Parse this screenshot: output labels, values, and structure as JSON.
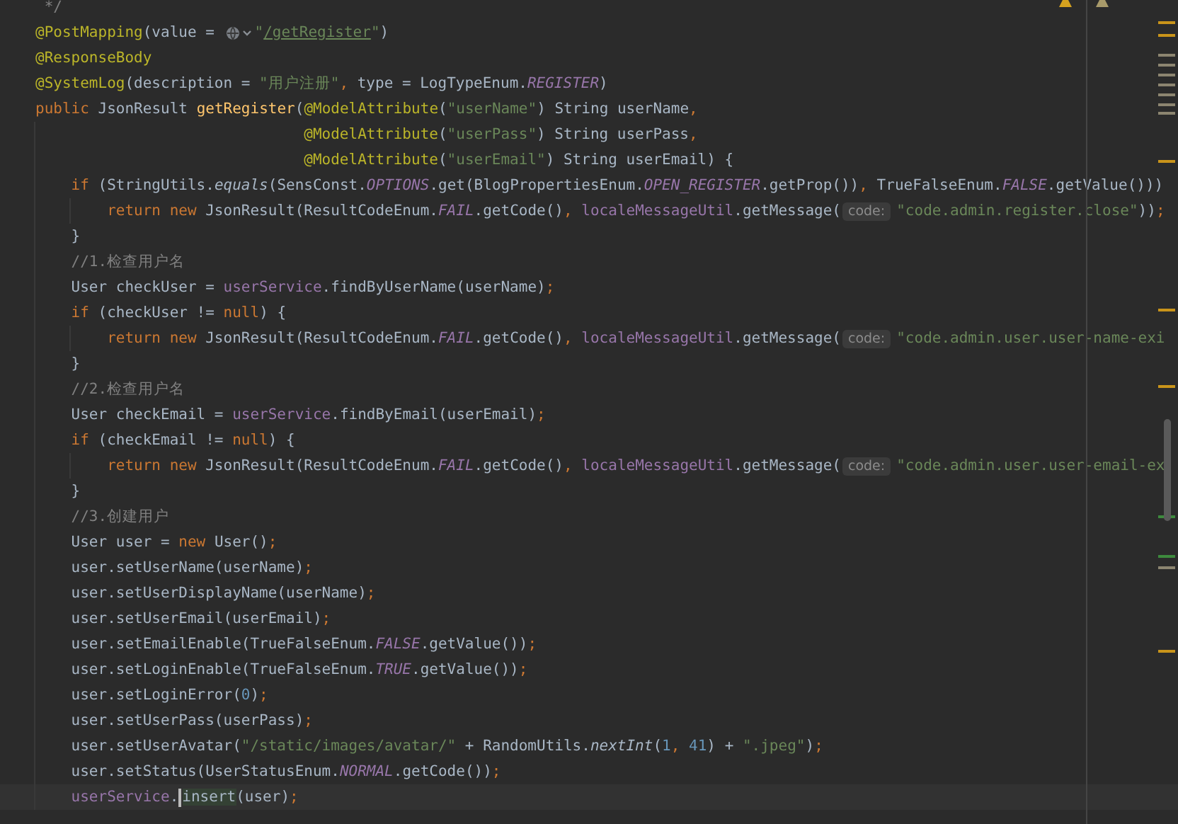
{
  "editor": {
    "lines": [
      {
        "current": false,
        "tokens": [
          {
            "kind": "comment",
            "text": " */"
          }
        ]
      },
      {
        "current": false,
        "tokens": [
          {
            "kind": "annotation",
            "text": "@PostMapping"
          },
          {
            "kind": "plain",
            "text": "(value = "
          },
          {
            "kind": "globe-icon"
          },
          {
            "kind": "string",
            "text": "\""
          },
          {
            "kind": "url",
            "text": "/getRegister"
          },
          {
            "kind": "string",
            "text": "\""
          },
          {
            "kind": "plain",
            "text": ")"
          }
        ]
      },
      {
        "current": false,
        "tokens": [
          {
            "kind": "annotation",
            "text": "@ResponseBody"
          }
        ]
      },
      {
        "current": false,
        "tokens": [
          {
            "kind": "annotation",
            "text": "@SystemLog"
          },
          {
            "kind": "plain",
            "text": "(description = "
          },
          {
            "kind": "string",
            "text": "\"用户注册\""
          },
          {
            "kind": "punct",
            "text": ", "
          },
          {
            "kind": "plain",
            "text": "type = LogTypeEnum."
          },
          {
            "kind": "constant",
            "text": "REGISTER"
          },
          {
            "kind": "plain",
            "text": ")"
          }
        ]
      },
      {
        "current": false,
        "tokens": [
          {
            "kind": "keyword",
            "text": "public "
          },
          {
            "kind": "plain",
            "text": "JsonResult "
          },
          {
            "kind": "method",
            "text": "getRegister"
          },
          {
            "kind": "plain",
            "text": "("
          },
          {
            "kind": "annotation",
            "text": "@ModelAttribute"
          },
          {
            "kind": "plain",
            "text": "("
          },
          {
            "kind": "string",
            "text": "\"userName\""
          },
          {
            "kind": "plain",
            "text": ") String userName"
          },
          {
            "kind": "punct",
            "text": ","
          }
        ]
      },
      {
        "current": false,
        "tokens": [
          {
            "kind": "annotation",
            "text": "                              @ModelAttribute"
          },
          {
            "kind": "plain",
            "text": "("
          },
          {
            "kind": "string",
            "text": "\"userPass\""
          },
          {
            "kind": "plain",
            "text": ") String userPass"
          },
          {
            "kind": "punct",
            "text": ","
          }
        ]
      },
      {
        "current": false,
        "tokens": [
          {
            "kind": "annotation",
            "text": "                              @ModelAttribute"
          },
          {
            "kind": "plain",
            "text": "("
          },
          {
            "kind": "string",
            "text": "\"userEmail\""
          },
          {
            "kind": "plain",
            "text": ") String userEmail) {"
          }
        ]
      },
      {
        "current": false,
        "tokens": [
          {
            "kind": "keyword",
            "text": "    if "
          },
          {
            "kind": "plain",
            "text": "(StringUtils."
          },
          {
            "kind": "static",
            "text": "equals"
          },
          {
            "kind": "plain",
            "text": "(SensConst."
          },
          {
            "kind": "constant",
            "text": "OPTIONS"
          },
          {
            "kind": "plain",
            "text": ".get(BlogPropertiesEnum."
          },
          {
            "kind": "constant",
            "text": "OPEN_REGISTER"
          },
          {
            "kind": "plain",
            "text": ".getProp())"
          },
          {
            "kind": "punct",
            "text": ", "
          },
          {
            "kind": "plain",
            "text": "TrueFalseEnum."
          },
          {
            "kind": "constant",
            "text": "FALSE"
          },
          {
            "kind": "plain",
            "text": ".getValue()))"
          }
        ]
      },
      {
        "current": false,
        "tokens": [
          {
            "kind": "keyword",
            "text": "        return new "
          },
          {
            "kind": "plain",
            "text": "JsonResult(ResultCodeEnum."
          },
          {
            "kind": "constant",
            "text": "FAIL"
          },
          {
            "kind": "plain",
            "text": ".getCode()"
          },
          {
            "kind": "punct",
            "text": ", "
          },
          {
            "kind": "field",
            "text": "localeMessageUtil"
          },
          {
            "kind": "plain",
            "text": ".getMessage("
          },
          {
            "kind": "hint",
            "text": "code:"
          },
          {
            "kind": "string",
            "text": "\"code.admin.register.close\""
          },
          {
            "kind": "plain",
            "text": "))"
          },
          {
            "kind": "punct",
            "text": ";"
          }
        ]
      },
      {
        "current": false,
        "tokens": [
          {
            "kind": "plain",
            "text": "    }"
          }
        ]
      },
      {
        "current": false,
        "tokens": [
          {
            "kind": "comment",
            "text": "    //1.检查用户名"
          }
        ]
      },
      {
        "current": false,
        "tokens": [
          {
            "kind": "plain",
            "text": "    User checkUser = "
          },
          {
            "kind": "field",
            "text": "userService"
          },
          {
            "kind": "plain",
            "text": ".findByUserName(userName)"
          },
          {
            "kind": "punct",
            "text": ";"
          }
        ]
      },
      {
        "current": false,
        "tokens": [
          {
            "kind": "keyword",
            "text": "    if "
          },
          {
            "kind": "plain",
            "text": "(checkUser != "
          },
          {
            "kind": "keyword",
            "text": "null"
          },
          {
            "kind": "plain",
            "text": ") {"
          }
        ]
      },
      {
        "current": false,
        "tokens": [
          {
            "kind": "keyword",
            "text": "        return new "
          },
          {
            "kind": "plain",
            "text": "JsonResult(ResultCodeEnum."
          },
          {
            "kind": "constant",
            "text": "FAIL"
          },
          {
            "kind": "plain",
            "text": ".getCode()"
          },
          {
            "kind": "punct",
            "text": ", "
          },
          {
            "kind": "field",
            "text": "localeMessageUtil"
          },
          {
            "kind": "plain",
            "text": ".getMessage("
          },
          {
            "kind": "hint",
            "text": "code:"
          },
          {
            "kind": "string",
            "text": "\"code.admin.user.user-name-exi"
          }
        ]
      },
      {
        "current": false,
        "tokens": [
          {
            "kind": "plain",
            "text": "    }"
          }
        ]
      },
      {
        "current": false,
        "tokens": [
          {
            "kind": "comment",
            "text": "    //2.检查用户名"
          }
        ]
      },
      {
        "current": false,
        "tokens": [
          {
            "kind": "plain",
            "text": "    User checkEmail = "
          },
          {
            "kind": "field",
            "text": "userService"
          },
          {
            "kind": "plain",
            "text": ".findByEmail(userEmail)"
          },
          {
            "kind": "punct",
            "text": ";"
          }
        ]
      },
      {
        "current": false,
        "tokens": [
          {
            "kind": "keyword",
            "text": "    if "
          },
          {
            "kind": "plain",
            "text": "(checkEmail != "
          },
          {
            "kind": "keyword",
            "text": "null"
          },
          {
            "kind": "plain",
            "text": ") {"
          }
        ]
      },
      {
        "current": false,
        "tokens": [
          {
            "kind": "keyword",
            "text": "        return new "
          },
          {
            "kind": "plain",
            "text": "JsonResult(ResultCodeEnum."
          },
          {
            "kind": "constant",
            "text": "FAIL"
          },
          {
            "kind": "plain",
            "text": ".getCode()"
          },
          {
            "kind": "punct",
            "text": ", "
          },
          {
            "kind": "field",
            "text": "localeMessageUtil"
          },
          {
            "kind": "plain",
            "text": ".getMessage("
          },
          {
            "kind": "hint",
            "text": "code:"
          },
          {
            "kind": "string",
            "text": "\"code.admin.user.user-email-ex"
          }
        ]
      },
      {
        "current": false,
        "tokens": [
          {
            "kind": "plain",
            "text": "    }"
          }
        ]
      },
      {
        "current": false,
        "tokens": [
          {
            "kind": "comment",
            "text": "    //3.创建用户"
          }
        ]
      },
      {
        "current": false,
        "tokens": [
          {
            "kind": "plain",
            "text": "    User user = "
          },
          {
            "kind": "keyword",
            "text": "new "
          },
          {
            "kind": "plain",
            "text": "User()"
          },
          {
            "kind": "punct",
            "text": ";"
          }
        ]
      },
      {
        "current": false,
        "tokens": [
          {
            "kind": "plain",
            "text": "    user.setUserName(userName)"
          },
          {
            "kind": "punct",
            "text": ";"
          }
        ]
      },
      {
        "current": false,
        "tokens": [
          {
            "kind": "plain",
            "text": "    user.setUserDisplayName(userName)"
          },
          {
            "kind": "punct",
            "text": ";"
          }
        ]
      },
      {
        "current": false,
        "tokens": [
          {
            "kind": "plain",
            "text": "    user.setUserEmail(userEmail)"
          },
          {
            "kind": "punct",
            "text": ";"
          }
        ]
      },
      {
        "current": false,
        "tokens": [
          {
            "kind": "plain",
            "text": "    user.setEmailEnable(TrueFalseEnum."
          },
          {
            "kind": "constant",
            "text": "FALSE"
          },
          {
            "kind": "plain",
            "text": ".getValue())"
          },
          {
            "kind": "punct",
            "text": ";"
          }
        ]
      },
      {
        "current": false,
        "tokens": [
          {
            "kind": "plain",
            "text": "    user.setLoginEnable(TrueFalseEnum."
          },
          {
            "kind": "constant",
            "text": "TRUE"
          },
          {
            "kind": "plain",
            "text": ".getValue())"
          },
          {
            "kind": "punct",
            "text": ";"
          }
        ]
      },
      {
        "current": false,
        "tokens": [
          {
            "kind": "plain",
            "text": "    user.setLoginError("
          },
          {
            "kind": "number",
            "text": "0"
          },
          {
            "kind": "plain",
            "text": ")"
          },
          {
            "kind": "punct",
            "text": ";"
          }
        ]
      },
      {
        "current": false,
        "tokens": [
          {
            "kind": "plain",
            "text": "    user.setUserPass(userPass)"
          },
          {
            "kind": "punct",
            "text": ";"
          }
        ]
      },
      {
        "current": false,
        "tokens": [
          {
            "kind": "plain",
            "text": "    user.setUserAvatar("
          },
          {
            "kind": "string",
            "text": "\"/static/images/avatar/\""
          },
          {
            "kind": "plain",
            "text": " + RandomUtils."
          },
          {
            "kind": "static",
            "text": "nextInt"
          },
          {
            "kind": "plain",
            "text": "("
          },
          {
            "kind": "number",
            "text": "1"
          },
          {
            "kind": "punct",
            "text": ", "
          },
          {
            "kind": "number",
            "text": "41"
          },
          {
            "kind": "plain",
            "text": ") + "
          },
          {
            "kind": "string",
            "text": "\".jpeg\""
          },
          {
            "kind": "plain",
            "text": ")"
          },
          {
            "kind": "punct",
            "text": ";"
          }
        ]
      },
      {
        "current": false,
        "tokens": [
          {
            "kind": "plain",
            "text": "    user.setStatus(UserStatusEnum."
          },
          {
            "kind": "constant",
            "text": "NORMAL"
          },
          {
            "kind": "plain",
            "text": ".getCode())"
          },
          {
            "kind": "punct",
            "text": ";"
          }
        ]
      },
      {
        "current": true,
        "tokens": [
          {
            "kind": "field",
            "text": "    userService"
          },
          {
            "kind": "plain",
            "text": "."
          },
          {
            "kind": "usage",
            "text": "insert"
          },
          {
            "kind": "plain",
            "text": "(user)"
          },
          {
            "kind": "punct",
            "text": ";"
          }
        ]
      }
    ]
  }
}
